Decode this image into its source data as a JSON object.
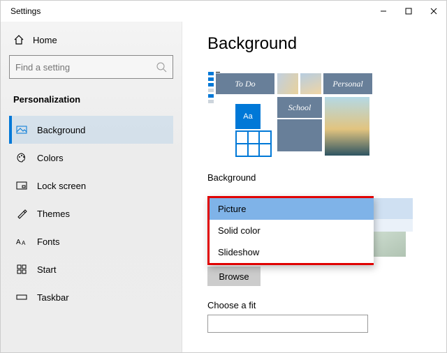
{
  "window": {
    "title": "Settings"
  },
  "sidebar": {
    "home": "Home",
    "search_placeholder": "Find a setting",
    "section": "Personalization",
    "items": [
      {
        "label": "Background",
        "icon": "picture-icon",
        "active": true
      },
      {
        "label": "Colors",
        "icon": "palette-icon",
        "active": false
      },
      {
        "label": "Lock screen",
        "icon": "lockscreen-icon",
        "active": false
      },
      {
        "label": "Themes",
        "icon": "themes-icon",
        "active": false
      },
      {
        "label": "Fonts",
        "icon": "fonts-icon",
        "active": false
      },
      {
        "label": "Start",
        "icon": "start-icon",
        "active": false
      },
      {
        "label": "Taskbar",
        "icon": "taskbar-icon",
        "active": false
      }
    ]
  },
  "main": {
    "title": "Background",
    "preview_tiles": {
      "todo": "To Do",
      "personal": "Personal",
      "school": "School",
      "sample": "Aa"
    },
    "background_label": "Background",
    "dropdown": {
      "options": [
        "Picture",
        "Solid color",
        "Slideshow"
      ],
      "selected": "Picture"
    },
    "browse_label": "Browse",
    "fit_label": "Choose a fit"
  },
  "colors": {
    "accent": "#0078d7",
    "highlight_box": "#e00000",
    "tile": "#687f99"
  }
}
